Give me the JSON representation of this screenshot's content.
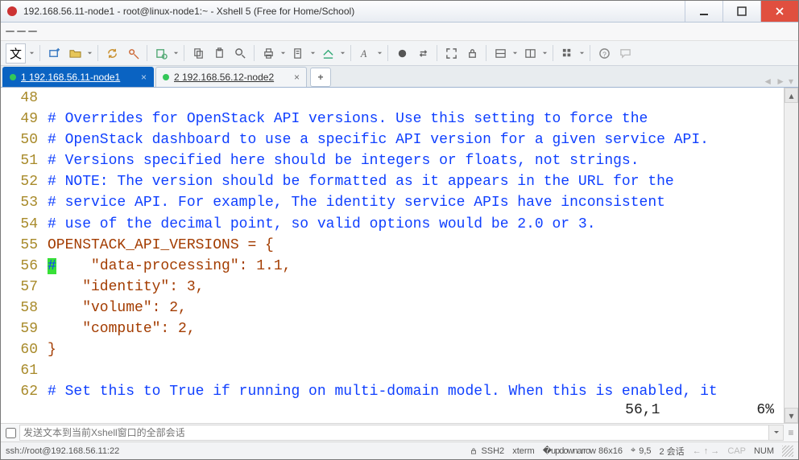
{
  "window": {
    "title": "192.168.56.11-node1 - root@linux-node1:~ - Xshell 5 (Free for Home/School)"
  },
  "tabs": {
    "items": [
      {
        "label": "1 192.168.56.11-node1",
        "active": true
      },
      {
        "label": "2 192.168.56.12-node2",
        "active": false
      }
    ],
    "add": "+"
  },
  "toolbar": {
    "wen": "文"
  },
  "code": {
    "lines": [
      {
        "n": "48",
        "t": ""
      },
      {
        "n": "49",
        "cm": "# Overrides for OpenStack API versions. Use this setting to force the"
      },
      {
        "n": "50",
        "cm": "# OpenStack dashboard to use a specific API version for a given service API."
      },
      {
        "n": "51",
        "cm": "# Versions specified here should be integers or floats, not strings."
      },
      {
        "n": "52",
        "cm": "# NOTE: The version should be formatted as it appears in the URL for the"
      },
      {
        "n": "53",
        "cm": "# service API. For example, The identity service APIs have inconsistent"
      },
      {
        "n": "54",
        "cm": "# use of the decimal point, so valid options would be 2.0 or 3."
      },
      {
        "n": "55",
        "kw": "OPENSTACK_API_VERSIONS = {"
      },
      {
        "n": "56",
        "hash": "#",
        "kw2": "    \"data-processing\": 1.1,"
      },
      {
        "n": "57",
        "kw": "    \"identity\": 3,"
      },
      {
        "n": "58",
        "kw": "    \"volume\": 2,"
      },
      {
        "n": "59",
        "kw": "    \"compute\": 2,"
      },
      {
        "n": "60",
        "kw": "}"
      },
      {
        "n": "61",
        "t": ""
      },
      {
        "n": "62",
        "cm": "# Set this to True if running on multi-domain model. When this is enabled, it"
      }
    ]
  },
  "vim": {
    "pos": "56,1",
    "pct": "6%"
  },
  "sendbar": {
    "placeholder": "发送文本到当前Xshell窗口的全部会话"
  },
  "status": {
    "conn": "ssh://root@192.168.56.11:22",
    "proto": "SSH2",
    "term": "xterm",
    "size": "86x16",
    "cursor": "9,5",
    "sessions": "2 会话",
    "caps": "CAP",
    "num": "NUM"
  },
  "icons": {
    "app": "xshell-icon"
  }
}
